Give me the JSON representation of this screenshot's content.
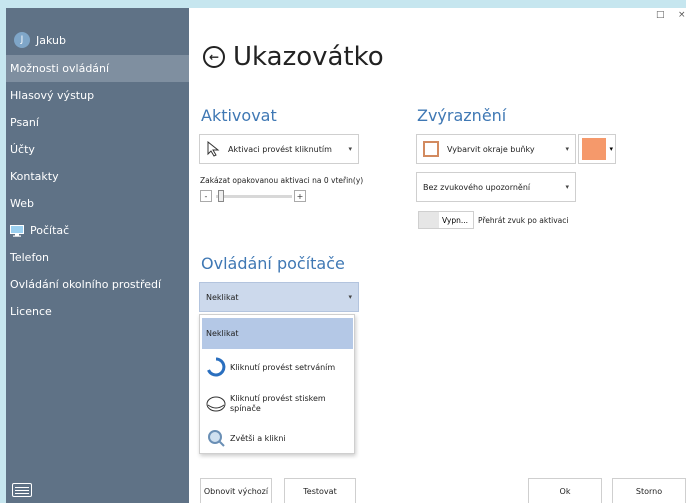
{
  "user": {
    "initial": "J",
    "name": "Jakub"
  },
  "nav": [
    {
      "label": "Možnosti ovládání",
      "active": true
    },
    {
      "label": "Hlasový výstup"
    },
    {
      "label": "Psaní"
    },
    {
      "label": "Účty"
    },
    {
      "label": "Kontakty"
    },
    {
      "label": "Web"
    },
    {
      "label": "Počítač",
      "icon": "monitor-icon"
    },
    {
      "label": "Telefon"
    },
    {
      "label": "Ovládání okolního prostředí"
    },
    {
      "label": "Licence"
    }
  ],
  "window": {
    "restore": "□",
    "close": "×"
  },
  "page": {
    "title": "Ukazovátko",
    "back": "←"
  },
  "activate": {
    "heading": "Aktivovat",
    "select_value": "Aktivaci provést kliknutím",
    "delay_label": "Zakázat opakovanou aktivaci na 0 vteřin(y)",
    "minus": "-",
    "plus": "+",
    "delay_seconds": 0
  },
  "highlight": {
    "heading": "Zvýraznění",
    "select_value": "Vybarvit okraje buňky",
    "color": "#f5996b",
    "sound_value": "Bez zvukového upozornění",
    "toggle_state": "Vypn...",
    "toggle_label": "Přehrát zvuk po aktivaci"
  },
  "pc_control": {
    "heading": "Ovládání počítače",
    "select_value": "Neklikat",
    "options": [
      {
        "label": "Neklikat",
        "icon": "",
        "selected": true
      },
      {
        "label": "Kliknutí provést setrváním",
        "icon": "dwell-ring-icon"
      },
      {
        "label": "Kliknutí provést stiskem spínače",
        "icon": "switch-icon"
      },
      {
        "label": "Zvětši a klikni",
        "icon": "magnifier-icon"
      }
    ]
  },
  "footer": {
    "reset": "Obnovit výchozí",
    "test": "Testovat",
    "ok": "Ok",
    "cancel": "Storno"
  },
  "colors": {
    "sidebar": "#5f7286",
    "accent": "#3f78b4",
    "selected": "#b4c8e6"
  }
}
